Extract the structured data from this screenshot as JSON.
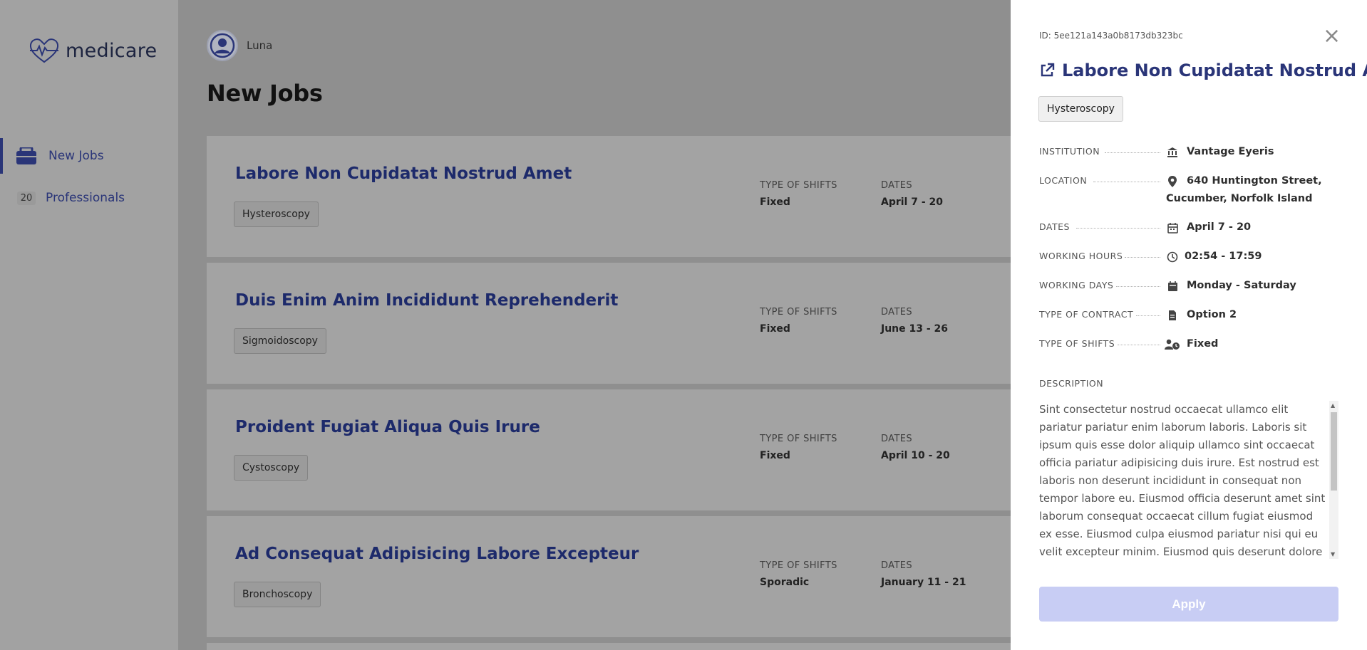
{
  "app": {
    "name": "medicare"
  },
  "sidebar": {
    "items": [
      {
        "label": "New Jobs",
        "icon": "briefcase-icon",
        "active": true
      },
      {
        "label": "Professionals",
        "count": "20"
      }
    ]
  },
  "user": {
    "name": "Luna"
  },
  "page": {
    "title": "New Jobs"
  },
  "jobs": [
    {
      "title": "Labore Non Cupidatat Nostrud Amet",
      "tag": "Hysteroscopy",
      "shifts_label": "TYPE OF SHIFTS",
      "shifts": "Fixed",
      "dates_label": "DATES",
      "dates": "April 7 - 20"
    },
    {
      "title": "Duis Enim Anim Incididunt Reprehenderit",
      "tag": "Sigmoidoscopy",
      "shifts_label": "TYPE OF SHIFTS",
      "shifts": "Fixed",
      "dates_label": "DATES",
      "dates": "June 13 - 26"
    },
    {
      "title": "Proident Fugiat Aliqua Quis Irure",
      "tag": "Cystoscopy",
      "shifts_label": "TYPE OF SHIFTS",
      "shifts": "Fixed",
      "dates_label": "DATES",
      "dates": "April 10 - 20"
    },
    {
      "title": "Ad Consequat Adipisicing Labore Excepteur",
      "tag": "Bronchoscopy",
      "shifts_label": "TYPE OF SHIFTS",
      "shifts": "Sporadic",
      "dates_label": "DATES",
      "dates": "January 11 - 21"
    }
  ],
  "drawer": {
    "id": "ID: 5ee121a143a0b8173db323bc",
    "close": "×",
    "title": "Labore Non Cupidatat Nostrud Amet",
    "tag": "Hysteroscopy",
    "details": [
      {
        "label": "INSTITUTION",
        "icon": "institution-icon",
        "value": "Vantage Eyeris"
      },
      {
        "label": "LOCATION",
        "icon": "location-pin-icon",
        "value_line1": "640 Huntington Street,",
        "value_line2": "Cucumber, Norfolk Island"
      },
      {
        "label": "DATES",
        "icon": "calendar-icon",
        "value": "April 7 - 20"
      },
      {
        "label": "WORKING HOURS",
        "icon": "clock-icon",
        "value": "02:54 - 17:59"
      },
      {
        "label": "WORKING DAYS",
        "icon": "calendar-filled-icon",
        "value": "Monday - Saturday"
      },
      {
        "label": "TYPE OF CONTRACT",
        "icon": "document-icon",
        "value": "Option 2"
      },
      {
        "label": "TYPE OF SHIFTS",
        "icon": "user-clock-icon",
        "value": "Fixed"
      }
    ],
    "description_label": "DESCRIPTION",
    "description": "Sint consectetur nostrud occaecat ullamco elit pariatur pariatur enim laborum laboris. Laboris sit ipsum quis esse dolor aliquip ullamco sint occaecat officia pariatur adipisicing duis irure. Est nostrud est laboris non deserunt incididunt in consequat non tempor labore eu. Eiusmod officia deserunt amet sint laborum consequat occaecat cillum fugiat eiusmod ex esse. Eiusmod culpa eiusmod pariatur nisi qui eu velit excepteur minim. Eiusmod quis deserunt dolore nisi non sint ea proident amet deserunt",
    "apply": "Apply"
  },
  "colors": {
    "accent": "#2a3578",
    "apply_button": "#c8cdf4",
    "overlay": "#8f8f8f"
  }
}
